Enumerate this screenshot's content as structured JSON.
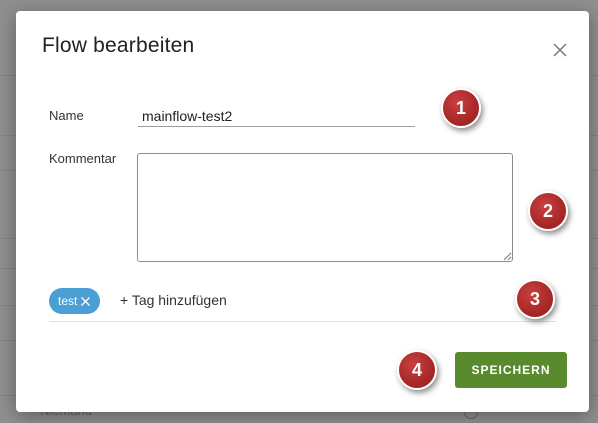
{
  "dialog": {
    "title": "Flow bearbeiten",
    "close_icon": "close-icon"
  },
  "form": {
    "name_label": "Name",
    "name_value": "mainflow-test2",
    "comment_label": "Kommentar",
    "comment_value": ""
  },
  "tags": {
    "items": [
      {
        "label": "test",
        "remove_icon": "close-icon"
      }
    ],
    "add_label": "+ Tag hinzufügen"
  },
  "actions": {
    "save_label": "SPEICHERN"
  },
  "markers": [
    "1",
    "2",
    "3",
    "4"
  ],
  "background": {
    "partial_text": "Niemand"
  },
  "colors": {
    "tag": "#4a9fd5",
    "save_button": "#5a8a2e",
    "marker": "#a82828"
  }
}
